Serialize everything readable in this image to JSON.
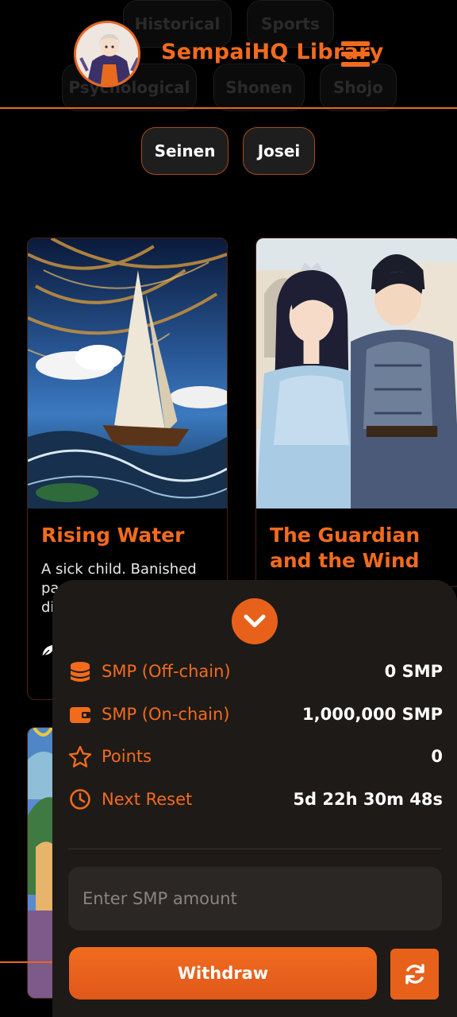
{
  "header": {
    "brand": "SempaiHQ Library",
    "avatar_icon": "anime-avatar",
    "menu_icon": "hamburger-menu-icon"
  },
  "genres": {
    "faded": [
      "Historical",
      "Sports",
      "Psychological",
      "Shonen",
      "Shojo"
    ],
    "active": [
      "Seinen",
      "Josei"
    ]
  },
  "cards": [
    {
      "title": "Rising Water",
      "description": "A sick child. Banished pa",
      "description_line3": "di",
      "art": "sailing-ship-in-storm"
    },
    {
      "title": "The Guardian and the Wind",
      "art": "princess-and-armored-knight"
    }
  ],
  "wallet": {
    "rows": [
      {
        "icon": "coins-stack-icon",
        "label": "SMP (Off-chain)",
        "value": "0 SMP"
      },
      {
        "icon": "wallet-icon",
        "label": "SMP (On-chain)",
        "value": "1,000,000 SMP"
      },
      {
        "icon": "star-icon",
        "label": "Points",
        "value": "0"
      },
      {
        "icon": "clock-icon",
        "label": "Next Reset",
        "value": "5d 22h 30m 48s"
      }
    ],
    "amount_placeholder": "Enter SMP amount",
    "withdraw_label": "Withdraw",
    "refresh_icon": "refresh-icon"
  },
  "colors": {
    "accent": "#f26b1d",
    "panel_bg": "#1e1a17",
    "input_bg": "#2b2724",
    "page_bg": "#000000"
  }
}
